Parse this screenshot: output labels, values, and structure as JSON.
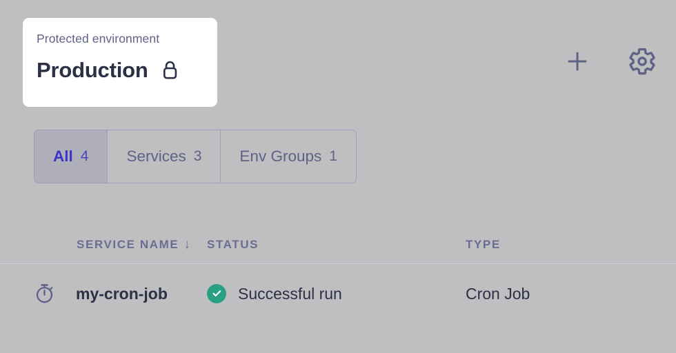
{
  "env_card": {
    "label": "Protected environment",
    "name": "Production",
    "lock_icon": "lock-icon"
  },
  "top_actions": {
    "add": {
      "icon": "plus-icon",
      "label": "+"
    },
    "settings": {
      "icon": "gear-icon",
      "label": ""
    }
  },
  "tabs": [
    {
      "label": "All",
      "count": "4",
      "active": true
    },
    {
      "label": "Services",
      "count": "3",
      "active": false
    },
    {
      "label": "Env Groups",
      "count": "1",
      "active": false
    }
  ],
  "table": {
    "columns": [
      {
        "label": "SERVICE NAME",
        "sort": "↓"
      },
      {
        "label": "STATUS",
        "sort": ""
      },
      {
        "label": "TYPE",
        "sort": ""
      }
    ],
    "rows": [
      {
        "icon": "stopwatch-icon",
        "name": "my-cron-job",
        "status_icon": "check-circle-icon",
        "status": "Successful run",
        "type": "Cron Job"
      }
    ]
  },
  "colors": {
    "overlay_background": "#bfbfc1",
    "card_background": "#ffffff",
    "accent_active_tab_text": "#3c34c9",
    "muted_text": "#5f6287",
    "heading_text": "#2b3044",
    "status_success": "#2aa083",
    "divider": "#c9cad8"
  }
}
